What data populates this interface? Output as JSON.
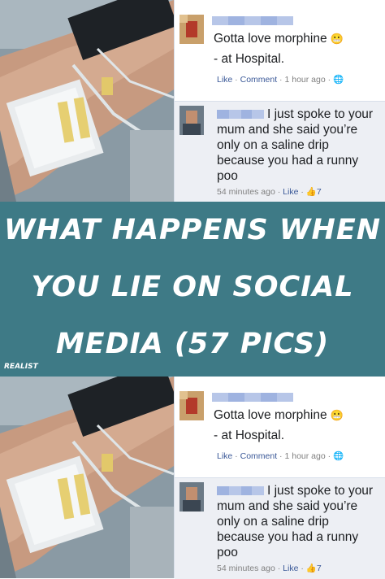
{
  "banner": {
    "line1": "WHAT HAPPENS WHEN",
    "line2": "YOU LIE ON SOCIAL",
    "line3": "MEDIA (57 PICS)",
    "watermark": "REALIST",
    "bg_color": "#3e7a86"
  },
  "panels": [
    {
      "post1": {
        "text": "Gotta love morphine",
        "emoji": "😬",
        "location": "- at Hospital.",
        "like": "Like",
        "comment": "Comment",
        "time": "1 hour ago",
        "globe_icon": "globe-icon"
      },
      "post2": {
        "text": "I just spoke to your mum and she said you’re only on a saline drip because you had a runny poo",
        "time": "54 minutes ago",
        "like": "Like",
        "likes_count": "7"
      }
    },
    {
      "post1": {
        "text": "Gotta love morphine",
        "emoji": "😬",
        "location": "- at Hospital.",
        "like": "Like",
        "comment": "Comment",
        "time": "1 hour ago",
        "globe_icon": "globe-icon"
      },
      "post2": {
        "text": "I just spoke to your mum and she said you’re only on a saline drip because you had a runny poo",
        "time": "54 minutes ago",
        "like": "Like",
        "likes_count": "7"
      }
    }
  ]
}
